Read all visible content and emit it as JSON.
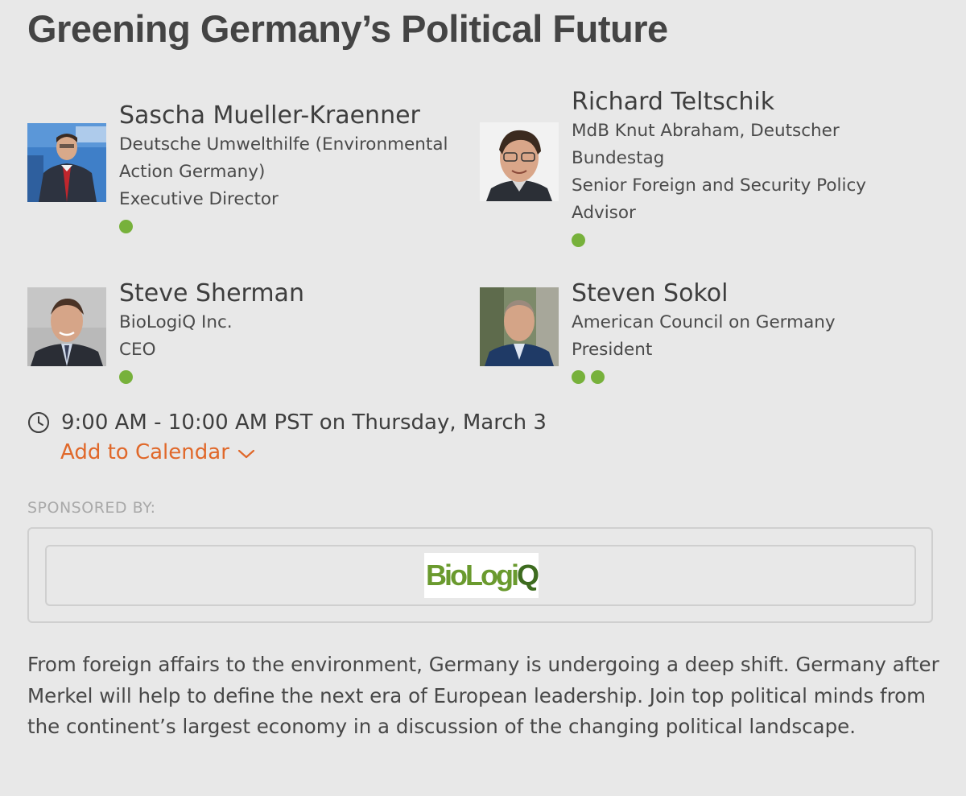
{
  "page": {
    "title": "Greening Germany’s Political Future"
  },
  "speakers": [
    {
      "name": "Sascha Mueller-Kraenner",
      "lines": [
        "Deutsche Umwelthilfe (Environmental",
        "Action Germany)",
        "Executive Director"
      ],
      "dot_count": 1
    },
    {
      "name": "Richard Teltschik",
      "lines": [
        "MdB Knut Abraham, Deutscher",
        "Bundestag",
        "Senior Foreign and Security Policy",
        "Advisor"
      ],
      "dot_count": 1
    },
    {
      "name": "Steve Sherman",
      "lines": [
        "BioLogiQ Inc.",
        "CEO"
      ],
      "dot_count": 1
    },
    {
      "name": "Steven Sokol",
      "lines": [
        "American Council on Germany",
        "President"
      ],
      "dot_count": 2
    }
  ],
  "event": {
    "time_text": "9:00 AM - 10:00 AM PST on Thursday, March 3",
    "add_to_calendar_label": "Add to Calendar",
    "clock_icon": "clock-icon",
    "chevron_icon": "chevron-down-icon"
  },
  "sponsor": {
    "label": "SPONSORED BY:",
    "logo_text_part1": "BioLogi",
    "logo_text_part2": "Q"
  },
  "description": "From foreign affairs to the environment, Germany is undergoing a deep shift. Germany after Merkel will help to define the next era of European leadership.  Join top political minds from the continent’s largest economy in a discussion of the changing political landscape.",
  "colors": {
    "background": "#e8e8e8",
    "accent_orange": "#e0682a",
    "status_green": "#77b13b",
    "logo_green": "#6a9a2e",
    "logo_dark_green": "#3d6b1f"
  }
}
